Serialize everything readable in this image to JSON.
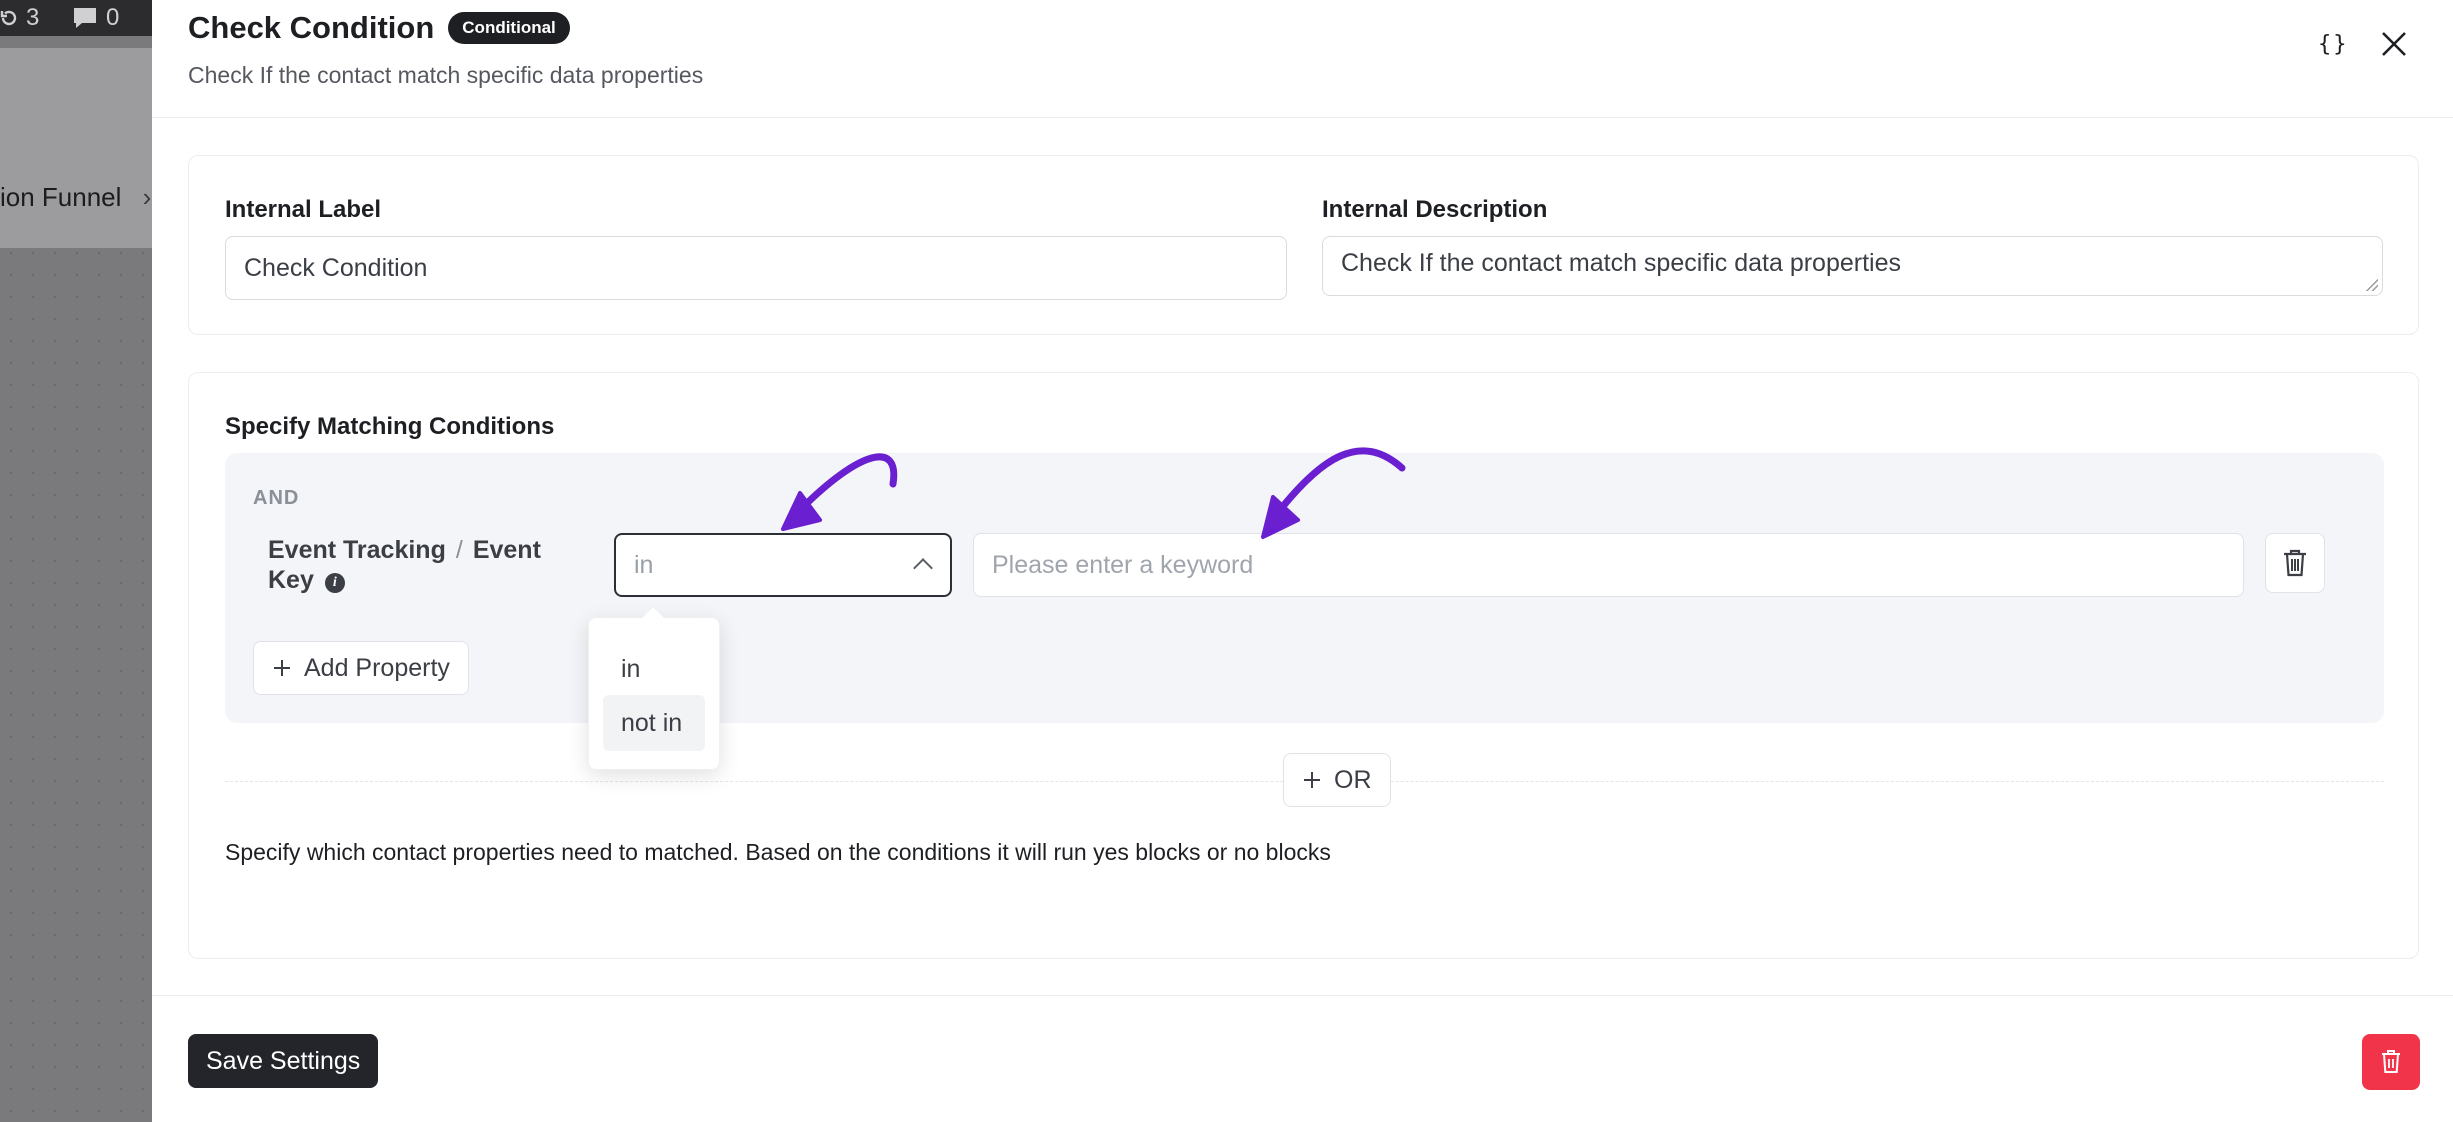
{
  "background_app": {
    "stat_1_count": "3",
    "stat_2_count": "0",
    "funnel_label": "ion Funnel"
  },
  "header": {
    "title": "Check Condition",
    "badge": "Conditional",
    "subtitle": "Check If the contact match specific data properties",
    "braces_icon": "{}"
  },
  "basic": {
    "label_title": "Internal Label",
    "label_value": "Check Condition",
    "description_title": "Internal Description",
    "description_value": "Check If the contact match specific data properties"
  },
  "conditions": {
    "section_title": "Specify Matching Conditions",
    "group_operator": "AND",
    "property_group": "Event Tracking",
    "property_separator": "/",
    "property_name": "Event Key",
    "operator_selected": "in",
    "operator_options": [
      "in",
      "not in"
    ],
    "keyword_placeholder": "Please enter a keyword",
    "add_property_label": "Add Property",
    "or_label": "OR",
    "help_text": "Specify which contact properties need to matched. Based on the conditions it will run yes blocks or no blocks"
  },
  "footer": {
    "save_label": "Save Settings"
  },
  "colors": {
    "annotation_arrow": "#6a1fd0",
    "delete_button": "#f2344a",
    "primary_dark": "#23252b"
  },
  "icons": [
    "refresh-icon",
    "comment-icon",
    "braces-icon",
    "close-icon",
    "info-icon",
    "chevron-up-icon",
    "trash-icon",
    "plus-icon"
  ]
}
